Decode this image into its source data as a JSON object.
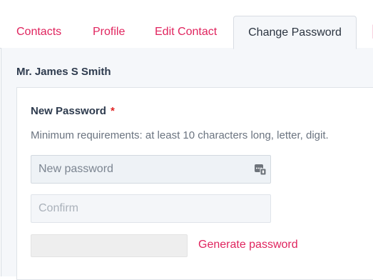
{
  "tabs": {
    "contacts": "Contacts",
    "profile": "Profile",
    "edit_contact": "Edit Contact",
    "change_password": "Change Password"
  },
  "account": {
    "name": "Mr. James S Smith"
  },
  "form": {
    "new_password_label": "New Password",
    "required_mark": "*",
    "requirements_hint": "Minimum requirements: at least 10 characters long, letter, digit.",
    "new_password_placeholder": "New password",
    "new_password_value": "",
    "confirm_placeholder": "Confirm",
    "confirm_value": "",
    "generate_link": "Generate password",
    "password_manager_icon": "password-keys-icon"
  },
  "colors": {
    "accent": "#e0245e",
    "required": "#e02424",
    "panel_bg": "#f5f7fa"
  }
}
